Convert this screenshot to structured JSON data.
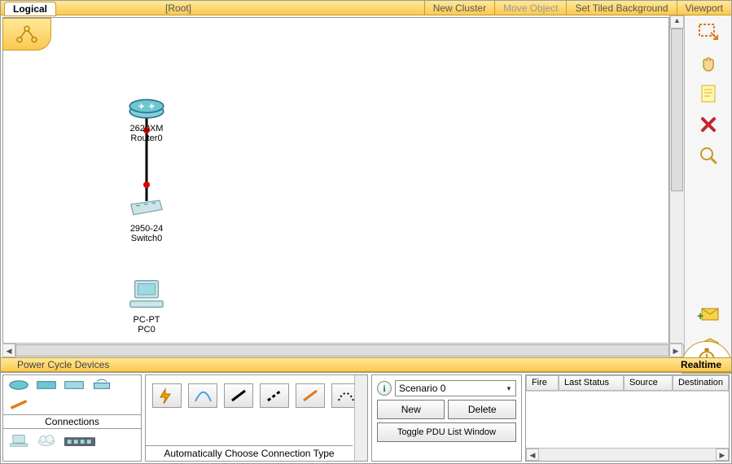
{
  "topbar": {
    "logical_tab": "Logical",
    "root": "[Root]",
    "new_cluster": "New Cluster",
    "move_object": "Move Object",
    "set_tiled_bg": "Set Tiled Background",
    "viewport": "Viewport"
  },
  "devices": {
    "router": {
      "model": "2620XM",
      "name": "Router0"
    },
    "switch": {
      "model": "2950-24",
      "name": "Switch0"
    },
    "pc": {
      "model": "PC-PT",
      "name": "PC0"
    }
  },
  "right_tools": {
    "select": "select-marquee",
    "hand": "hand-pan",
    "note": "note",
    "delete": "delete",
    "zoom": "zoom",
    "simple_pdu": "add-simple-pdu",
    "complex_pdu": "add-complex-pdu"
  },
  "midbar": {
    "left": "Power Cycle Devices",
    "right": "Realtime"
  },
  "panelA": {
    "title": "Connections"
  },
  "panelB": {
    "desc": "Automatically Choose Connection Type"
  },
  "panelC": {
    "scenario": "Scenario 0",
    "new": "New",
    "delete": "Delete",
    "toggle": "Toggle PDU List Window"
  },
  "panelD": {
    "cols": [
      "Fire",
      "Last Status",
      "Source",
      "Destination"
    ]
  }
}
